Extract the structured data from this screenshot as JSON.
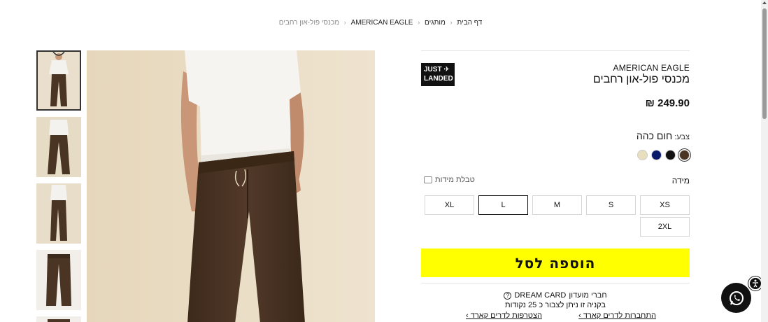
{
  "breadcrumb": {
    "items": [
      "דף הבית",
      "מותגים",
      "AMERICAN EAGLE"
    ],
    "current": "מכנסי פול-און רחבים"
  },
  "product": {
    "brand": "AMERICAN EAGLE",
    "title": "מכנסי פול-און רחבים",
    "price": "249.90 ₪",
    "badge_line1": "JUST",
    "badge_line2": "LANDED",
    "color_key": "צבע:",
    "color_value": "חום כהה",
    "colors": [
      "#4a3424",
      "#111111",
      "#0a1a6b",
      "#e8dfbf"
    ],
    "selected_color_index": 0,
    "size_label": "מידה",
    "size_chart_label": "טבלת מידות",
    "sizes": [
      "XS",
      "S",
      "M",
      "L",
      "XL",
      "2XL"
    ],
    "selected_size": "L",
    "add_to_cart": "הוספה לסל"
  },
  "club": {
    "line1_prefix": "חברי מועדון",
    "line1_name": "DREAM CARD",
    "line2": "בקניה זו ניתן לצבור כ 25 נקודות",
    "link_login": "התחברות לדרים קארד ›",
    "link_join": "הצטרפות לדרים קארד ›"
  },
  "icons": {
    "whatsapp": "whatsapp-icon",
    "accessibility": "accessibility-icon",
    "help": "question-icon",
    "size_chart": "ruler-icon"
  }
}
